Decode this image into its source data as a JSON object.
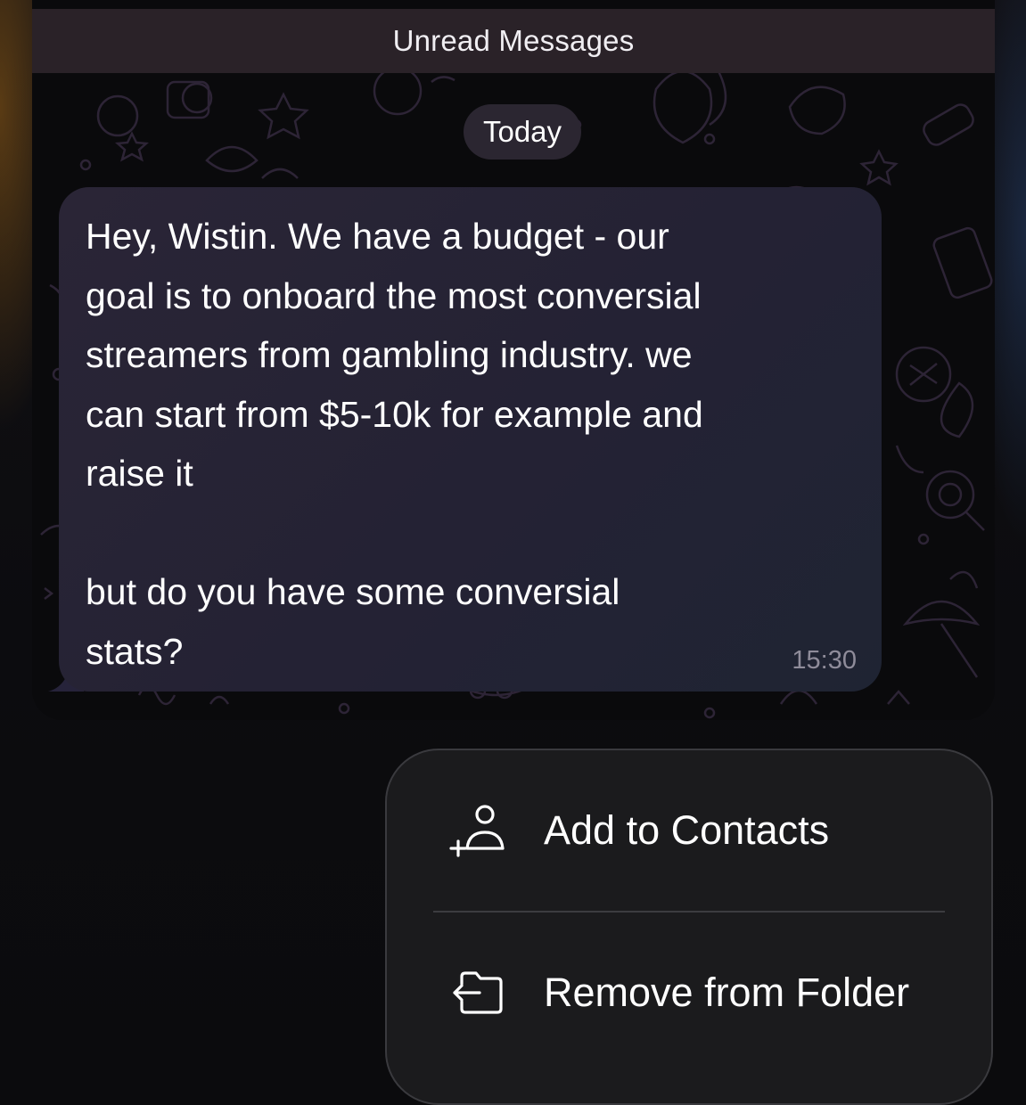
{
  "chat": {
    "unread_banner": "Unread Messages",
    "date_separator": "Today",
    "message": {
      "text": "Hey, Wistin. We have a budget - our\ngoal is to onboard the most conversial\nstreamers from gambling industry. we\ncan start from $5-10k for example and\nraise it\n\nbut do you have some conversial\nstats?",
      "time": "15:30"
    }
  },
  "context_menu": {
    "items": [
      {
        "label": "Add to Contacts",
        "icon": "add-contact-icon"
      },
      {
        "label": "Remove from Folder",
        "icon": "remove-folder-icon"
      }
    ]
  },
  "colors": {
    "bubble": "#262434",
    "unread_bar": "#2a2228",
    "menu_background": "#1b1b1d",
    "timestamp": "#8f8c9a"
  }
}
